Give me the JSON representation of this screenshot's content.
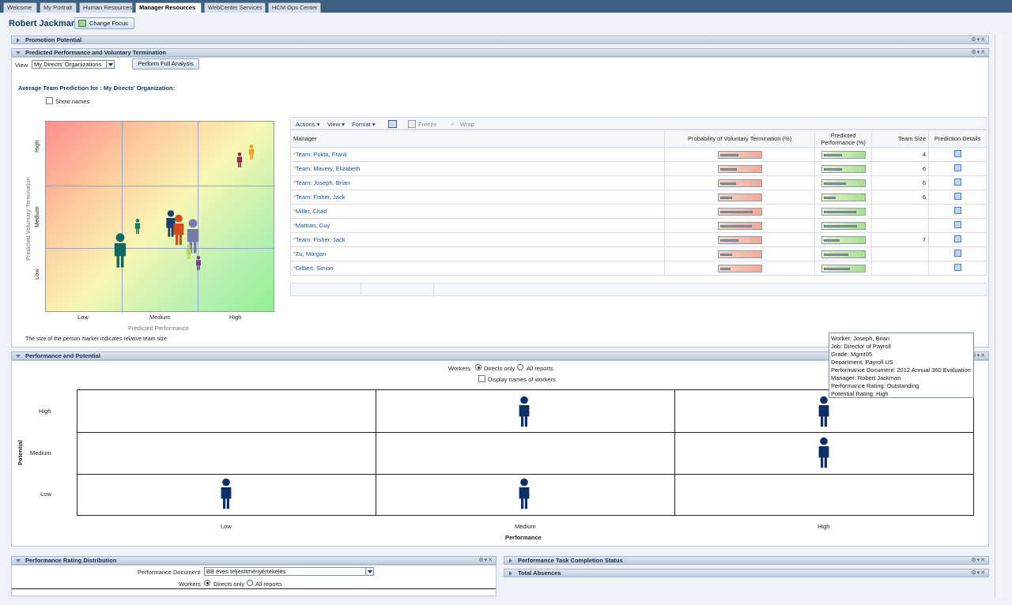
{
  "tabs": [
    {
      "label": "Welcome"
    },
    {
      "label": "My Portrait"
    },
    {
      "label": "Human Resources"
    },
    {
      "label": "Manager Resources"
    },
    {
      "label": "WebCenter Services"
    },
    {
      "label": "HCM Ops Center"
    }
  ],
  "header": {
    "person_name": "Robert Jackman",
    "change_focus": "Change Focus"
  },
  "sections": {
    "promotion_potential": "Promotion Potential",
    "predicted_perf": "Predicted Performance and Voluntary Termination",
    "perf_potential": "Performance and Potential",
    "rating_distribution": "Performance Rating Distribution",
    "task_completion": "Performance Task Completion Status",
    "absences": "Total Absences"
  },
  "predicted": {
    "view_label": "View",
    "view_value": "My Directs' Organizations",
    "analyze_button": "Perform Full Analysis",
    "subtitle": "Average Team Prediction for : My Directs' Organization:",
    "show_names": "Show names",
    "y_axis_label": "Predicted Voluntary Termination",
    "y_ticks": [
      "High",
      "Medium",
      "Low"
    ],
    "x_ticks": [
      "Low",
      "Medium",
      "High"
    ],
    "x_axis_label": "Predicted Performance",
    "footnote": "The size of the person marker indicates relative team size"
  },
  "toolbar": {
    "actions": "Actions",
    "view": "View",
    "format": "Format",
    "freeze": "Freeze",
    "wrap": "Wrap"
  },
  "table": {
    "columns": [
      "Manager",
      "Probability of Voluntary Termination (%)",
      "Predicted Performance (%)",
      "Team Size",
      "Prediction Details"
    ],
    "rows": [
      {
        "manager": "Team: Pukta, Frank",
        "term": 0.45,
        "perf": 0.45,
        "size": "4"
      },
      {
        "manager": "Team: Mavery, Elizabeth",
        "term": 0.42,
        "perf": 0.45,
        "size": "6"
      },
      {
        "manager": "Team: Joseph, Brian",
        "term": 0.4,
        "perf": 0.55,
        "size": "6"
      },
      {
        "manager": "Team: Fisher, Jack",
        "term": 0.3,
        "perf": 0.3,
        "size": "6"
      },
      {
        "manager": "Miller, Chad",
        "term": 0.8,
        "perf": 0.8,
        "size": ""
      },
      {
        "manager": "Mattran, Guy",
        "term": 0.78,
        "perf": 0.82,
        "size": ""
      },
      {
        "manager": "Team: Fisher, Jack",
        "term": 0.45,
        "perf": 0.4,
        "size": "7"
      },
      {
        "manager": "Zu, Morgan",
        "term": 0.3,
        "perf": 0.6,
        "size": ""
      },
      {
        "manager": "Gilbert, Simon",
        "term": 0.25,
        "perf": 0.65,
        "size": ""
      }
    ]
  },
  "tooltip": [
    "Worker: Joseph, Brian",
    "Job: Director of Payroll",
    "Grade: Mgmt05",
    "Department: Payroll US",
    "Performance Document: 2012 Annual 360 Evaluation",
    "Manager: Robert Jackman",
    "Performance Rating: Outstanding",
    "Potential Rating: High"
  ],
  "nine_box": {
    "workers_label": "Workers",
    "directs_only": "Directs only",
    "all_reports": "All reports",
    "display_names": "Display names of workers",
    "row_labels": [
      "High",
      "Medium",
      "Low"
    ],
    "col_labels": [
      "Low",
      "Medium",
      "High"
    ],
    "y_title": "Potential",
    "x_title": "Performance"
  },
  "distribution": {
    "doc_label": "Performance Document",
    "doc_value": "BB éves teljesítményértékelés",
    "workers_label": "Workers",
    "directs_only": "Directs only",
    "all_reports": "All reports"
  },
  "colors": {
    "tabbar": "#3d5f82",
    "accent": "#15396a",
    "worker_icon": "#0d2f66"
  }
}
